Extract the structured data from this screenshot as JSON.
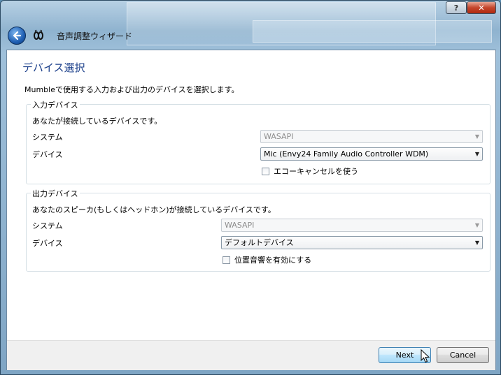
{
  "window": {
    "title": "音声調整ウィザード",
    "help_label": "?",
    "close_label": "✕"
  },
  "page": {
    "heading": "デバイス選択",
    "intro": "Mumbleで使用する入力および出力のデバイスを選択します。"
  },
  "input_group": {
    "legend": "入力デバイス",
    "description": "あなたが接続しているデバイスです。",
    "system_label": "システム",
    "system_value": "WASAPI",
    "device_label": "デバイス",
    "device_value": "Mic (Envy24 Family Audio Controller WDM)",
    "checkbox_label": "エコーキャンセルを使う"
  },
  "output_group": {
    "legend": "出力デバイス",
    "description": "あなたのスピーカ(もしくはヘッドホン)が接続しているデバイスです。",
    "system_label": "システム",
    "system_value": "WASAPI",
    "device_label": "デバイス",
    "device_value": "デフォルトデバイス",
    "checkbox_label": "位置音響を有効にする"
  },
  "footer": {
    "next_label": "Next",
    "cancel_label": "Cancel"
  },
  "icons": {
    "back": "back-arrow-icon",
    "app": "mumble-icon",
    "dropdown": "chevron-down-icon",
    "cursor": "mouse-pointer-icon"
  },
  "colors": {
    "heading": "#1a3e8a",
    "next_button": "#bee6fd",
    "close_button": "#c4452c"
  }
}
